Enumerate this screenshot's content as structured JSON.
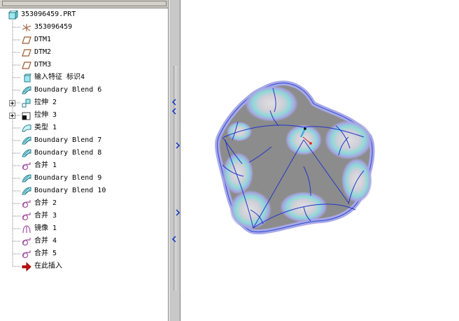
{
  "tree": {
    "items": [
      {
        "label": "353096459.PRT",
        "icon": "part-icon",
        "level": 0
      },
      {
        "label": "353096459",
        "icon": "coordinate-system-icon"
      },
      {
        "label": "DTM1",
        "icon": "datum-plane-icon"
      },
      {
        "label": "DTM2",
        "icon": "datum-plane-icon"
      },
      {
        "label": "DTM3",
        "icon": "datum-plane-icon"
      },
      {
        "label": "输入特征 标识4",
        "icon": "import-feature-icon"
      },
      {
        "label": "Boundary Blend 6",
        "icon": "boundary-blend-icon"
      },
      {
        "label": "拉伸 2",
        "icon": "extrude-icon",
        "expandable": true
      },
      {
        "label": "拉伸 3",
        "icon": "extrude-cut-icon",
        "expandable": true
      },
      {
        "label": "类型 1",
        "icon": "surface-type-icon"
      },
      {
        "label": "Boundary Blend 7",
        "icon": "boundary-blend-icon"
      },
      {
        "label": "Boundary Blend 8",
        "icon": "boundary-blend-icon"
      },
      {
        "label": "合并 1",
        "icon": "merge-icon"
      },
      {
        "label": "Boundary Blend 9",
        "icon": "boundary-blend-icon"
      },
      {
        "label": "Boundary Blend 10",
        "icon": "boundary-blend-icon"
      },
      {
        "label": "合并 2",
        "icon": "merge-icon"
      },
      {
        "label": "合并 3",
        "icon": "merge-icon"
      },
      {
        "label": "镜像 1",
        "icon": "mirror-icon"
      },
      {
        "label": "合并 4",
        "icon": "merge-icon"
      },
      {
        "label": "合并 5",
        "icon": "merge-icon"
      },
      {
        "label": "在此插入",
        "icon": "insert-here-arrow-icon"
      }
    ]
  },
  "colors": {
    "tree_bg": "#ffffff",
    "panel_gray": "#c0c0c0",
    "model_gray": "#8c8c8c",
    "model_edge": "#2040d0",
    "highlight_cyan": "#7fd8d8",
    "light_purple": "#aaaae0"
  }
}
